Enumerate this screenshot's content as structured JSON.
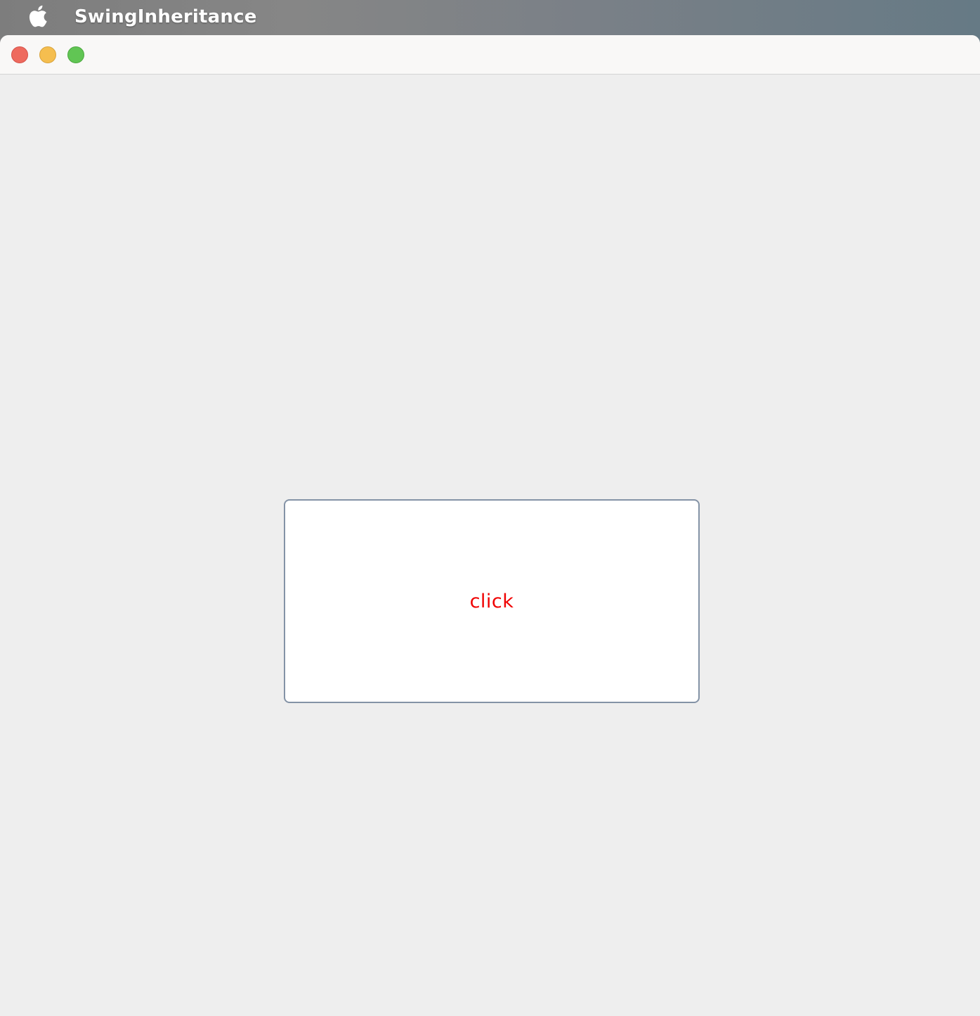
{
  "menubar": {
    "apple_icon": "apple-logo-icon",
    "app_name": "SwingInheritance"
  },
  "window": {
    "controls": {
      "close": "close-icon",
      "minimize": "minimize-icon",
      "zoom": "zoom-icon"
    },
    "colors": {
      "close": "#ee6a5e",
      "minimize": "#f5be4f",
      "zoom": "#61c554",
      "content_background": "#eeeeee"
    }
  },
  "main": {
    "button": {
      "label": "click",
      "label_color": "#f00000",
      "border_color": "#8493a6",
      "background": "#ffffff"
    }
  }
}
